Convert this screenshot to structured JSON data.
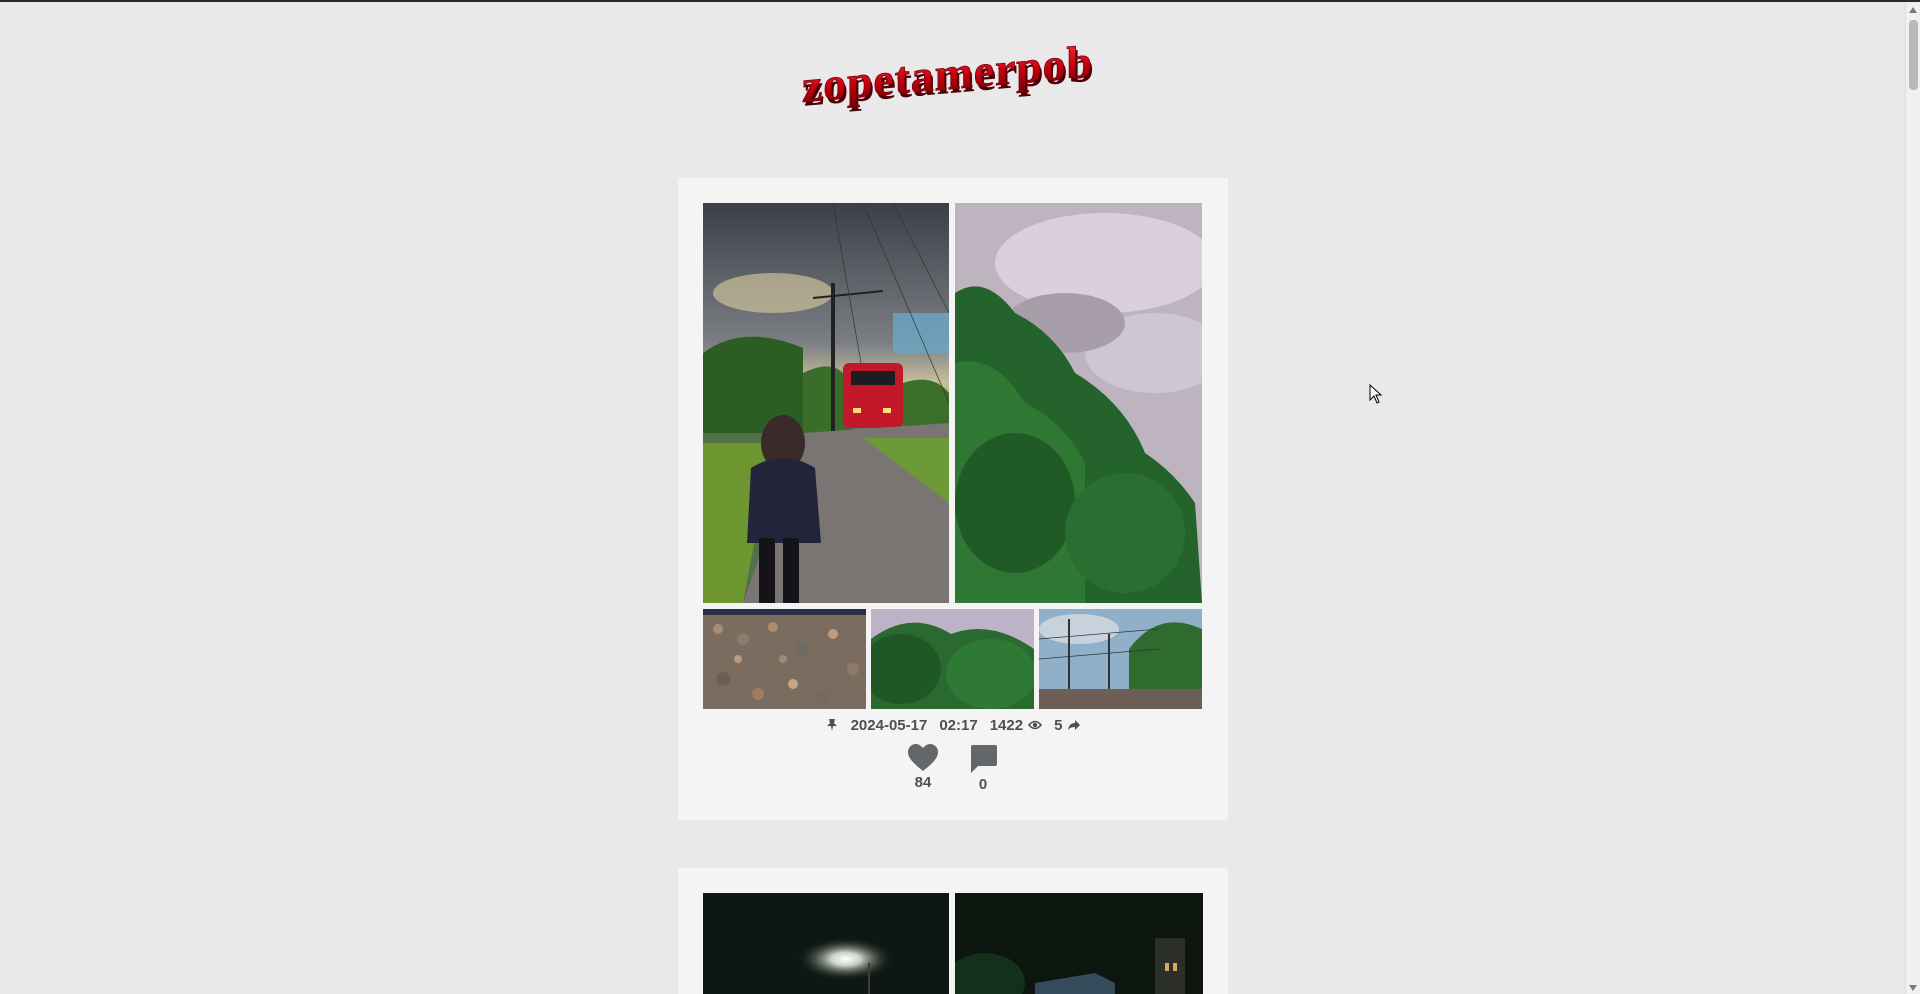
{
  "site": {
    "logo_text": "zopetamerpob",
    "logo_color": "#b8000e"
  },
  "posts": [
    {
      "date": "2024-05-17",
      "time": "02:17",
      "views": "1422",
      "shares": "5",
      "likes": "84",
      "comments": "0",
      "photos": [
        "railway-girl-train",
        "trees-cloudy-sky",
        "gravel-stones",
        "green-trees",
        "railway-power-lines"
      ]
    },
    {
      "photos": [
        "night-street-lamp",
        "night-house"
      ]
    }
  ],
  "icons": {
    "pin": "pin-icon",
    "views": "eye-icon",
    "shares": "share-arrow-icon",
    "like": "heart-icon",
    "comment": "speech-bubble-icon"
  }
}
